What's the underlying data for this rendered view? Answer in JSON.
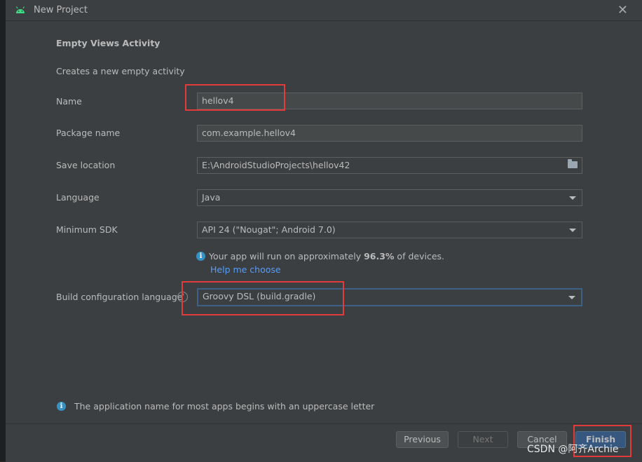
{
  "window": {
    "title": "New Project"
  },
  "heading": "Empty Views Activity",
  "subheading": "Creates a new empty activity",
  "form": {
    "name": {
      "label": "Name",
      "value": "hellov4"
    },
    "package": {
      "label": "Package name",
      "value": "com.example.hellov4"
    },
    "location": {
      "label": "Save location",
      "value": "E:\\AndroidStudioProjects\\hellov42"
    },
    "language": {
      "label": "Language",
      "value": "Java"
    },
    "min_sdk": {
      "label": "Minimum SDK",
      "value": "API 24 (\"Nougat\"; Android 7.0)"
    },
    "build_lang": {
      "label": "Build configuration language",
      "value": "Groovy DSL (build.gradle)"
    }
  },
  "info": {
    "prefix": "Your app will run on approximately ",
    "percent": "96.3%",
    "suffix": " of devices.",
    "link": "Help me choose"
  },
  "bottom_hint": "The application name for most apps begins with an uppercase letter",
  "buttons": {
    "previous": "Previous",
    "next": "Next",
    "cancel": "Cancel",
    "finish": "Finish"
  },
  "watermark": "CSDN @阿齐Archie",
  "colors": {
    "background": "#3c3f41",
    "field": "#45494a",
    "link": "#589df6",
    "primary": "#365880",
    "highlight": "#e03c3c"
  }
}
